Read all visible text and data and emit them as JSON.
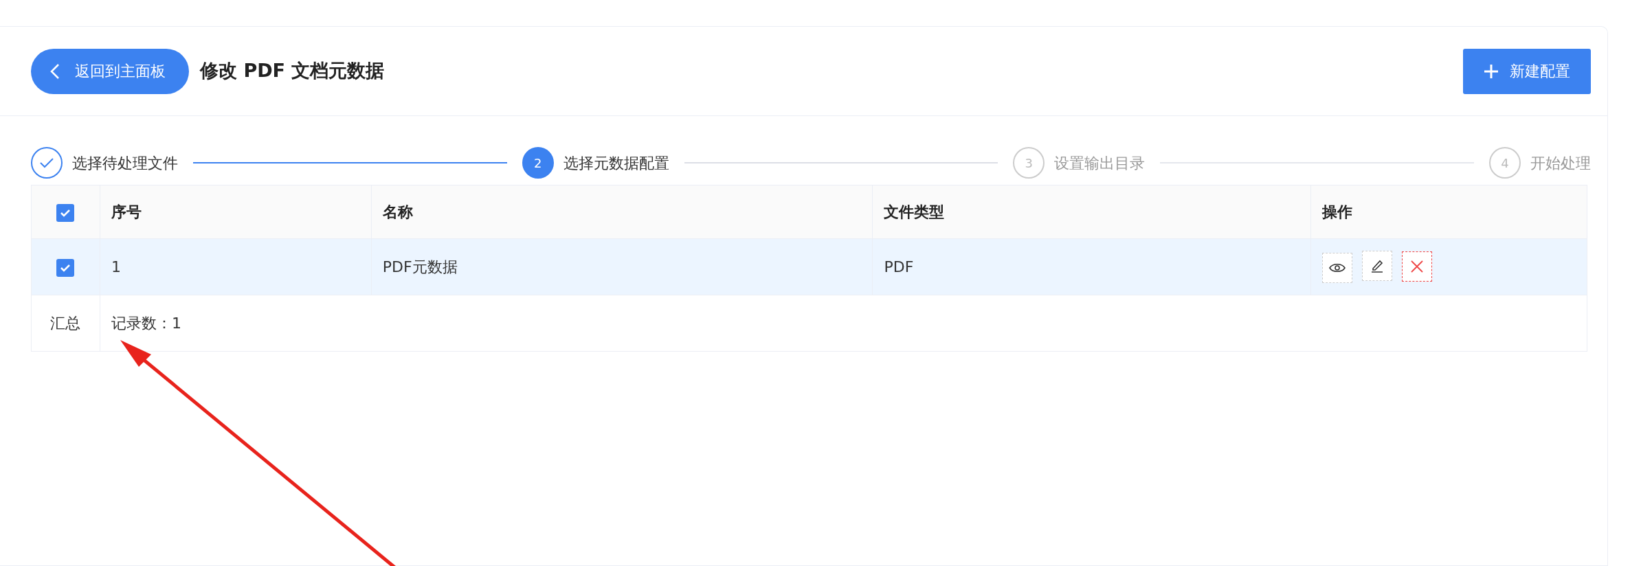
{
  "header": {
    "back_button": "返回到主面板",
    "title": "修改 PDF 文档元数据",
    "new_button": "新建配置"
  },
  "steps": [
    {
      "label": "选择待处理文件",
      "kind": "done"
    },
    {
      "number": "2",
      "label": "选择元数据配置",
      "kind": "active"
    },
    {
      "number": "3",
      "label": "设置输出目录",
      "kind": "pending"
    },
    {
      "number": "4",
      "label": "开始处理",
      "kind": "pending"
    }
  ],
  "table": {
    "select_all_checked": true,
    "columns": [
      "序号",
      "名称",
      "文件类型",
      "操作"
    ],
    "rows": [
      {
        "checked": true,
        "selected": true,
        "cells": [
          "1",
          "PDF元数据",
          "PDF"
        ]
      }
    ],
    "summary": {
      "label": "汇总",
      "text": "记录数：1"
    }
  }
}
